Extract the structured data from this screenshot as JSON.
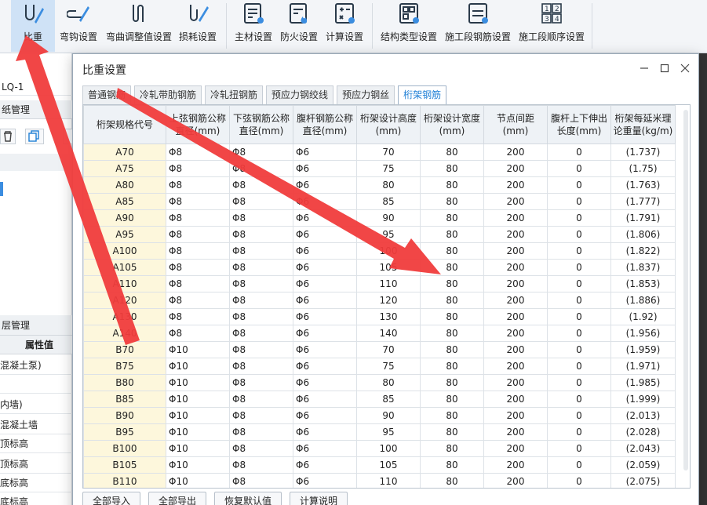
{
  "ribbon": {
    "buttons": [
      {
        "label": "比重",
        "icon": "ratio-icon"
      },
      {
        "label": "弯钩设置",
        "icon": "hook-icon"
      },
      {
        "label": "弯曲调整值设置",
        "icon": "bend-icon"
      },
      {
        "label": "损耗设置",
        "icon": "loss-icon"
      },
      {
        "label": "主材设置",
        "icon": "main-material-icon"
      },
      {
        "label": "防火设置",
        "icon": "fire-icon"
      },
      {
        "label": "计算设置",
        "icon": "calculator-icon"
      },
      {
        "label": "结构类型设置",
        "icon": "structure-icon"
      },
      {
        "label": "施工段钢筋设置",
        "icon": "segment-rebar-icon"
      },
      {
        "label": "施工段顺序设置",
        "icon": "sequence-icon"
      }
    ]
  },
  "left_panel": {
    "combo_value": "LQ-1",
    "drawing_mgmt": "纸管理",
    "floor_mgmt": "层管理",
    "prop_header": "属性值",
    "rows": [
      "混凝土泵)",
      "",
      "内墙)",
      "混凝土墙",
      "顶标高",
      "顶标高",
      "底标高",
      "底标高"
    ]
  },
  "dialog": {
    "title": "比重设置",
    "tabs": [
      "普通钢筋",
      "冷轧带肋钢筋",
      "冷轧扭钢筋",
      "预应力钢绞线",
      "预应力钢丝",
      "桁架钢筋"
    ],
    "active_tab": 5,
    "columns": [
      "桁架规格代号",
      "上弦钢筋公称直径(mm)",
      "下弦钢筋公称直径(mm)",
      "腹杆钢筋公称直径(mm)",
      "桁架设计高度(mm)",
      "桁架设计宽度(mm)",
      "节点间距(mm)",
      "腹杆上下伸出长度(mm)",
      "桁架每延米理论重量(kg/m)"
    ],
    "rows": [
      [
        "A70",
        "Φ8",
        "Φ8",
        "Φ6",
        "70",
        "80",
        "200",
        "0",
        "(1.737)"
      ],
      [
        "A75",
        "Φ8",
        "Φ8",
        "Φ6",
        "75",
        "80",
        "200",
        "0",
        "(1.75)"
      ],
      [
        "A80",
        "Φ8",
        "Φ8",
        "Φ6",
        "80",
        "80",
        "200",
        "0",
        "(1.763)"
      ],
      [
        "A85",
        "Φ8",
        "Φ8",
        "Φ6",
        "85",
        "80",
        "200",
        "0",
        "(1.777)"
      ],
      [
        "A90",
        "Φ8",
        "Φ8",
        "Φ6",
        "90",
        "80",
        "200",
        "0",
        "(1.791)"
      ],
      [
        "A95",
        "Φ8",
        "Φ8",
        "Φ6",
        "95",
        "80",
        "200",
        "0",
        "(1.806)"
      ],
      [
        "A100",
        "Φ8",
        "Φ8",
        "Φ6",
        "100",
        "80",
        "200",
        "0",
        "(1.822)"
      ],
      [
        "A105",
        "Φ8",
        "Φ8",
        "Φ6",
        "105",
        "80",
        "200",
        "0",
        "(1.837)"
      ],
      [
        "A110",
        "Φ8",
        "Φ8",
        "Φ6",
        "110",
        "80",
        "200",
        "0",
        "(1.853)"
      ],
      [
        "A120",
        "Φ8",
        "Φ8",
        "Φ6",
        "120",
        "80",
        "200",
        "0",
        "(1.886)"
      ],
      [
        "A130",
        "Φ8",
        "Φ8",
        "Φ6",
        "130",
        "80",
        "200",
        "0",
        "(1.92)"
      ],
      [
        "A140",
        "Φ8",
        "Φ8",
        "Φ6",
        "140",
        "80",
        "200",
        "0",
        "(1.956)"
      ],
      [
        "B70",
        "Φ10",
        "Φ8",
        "Φ6",
        "70",
        "80",
        "200",
        "0",
        "(1.959)"
      ],
      [
        "B75",
        "Φ10",
        "Φ8",
        "Φ6",
        "75",
        "80",
        "200",
        "0",
        "(1.971)"
      ],
      [
        "B80",
        "Φ10",
        "Φ8",
        "Φ6",
        "80",
        "80",
        "200",
        "0",
        "(1.985)"
      ],
      [
        "B85",
        "Φ10",
        "Φ8",
        "Φ6",
        "85",
        "80",
        "200",
        "0",
        "(1.999)"
      ],
      [
        "B90",
        "Φ10",
        "Φ8",
        "Φ6",
        "90",
        "80",
        "200",
        "0",
        "(2.013)"
      ],
      [
        "B95",
        "Φ10",
        "Φ8",
        "Φ6",
        "95",
        "80",
        "200",
        "0",
        "(2.028)"
      ],
      [
        "B100",
        "Φ10",
        "Φ8",
        "Φ6",
        "100",
        "80",
        "200",
        "0",
        "(2.043)"
      ],
      [
        "B105",
        "Φ10",
        "Φ8",
        "Φ6",
        "105",
        "80",
        "200",
        "0",
        "(2.059)"
      ],
      [
        "B110",
        "Φ10",
        "Φ8",
        "Φ6",
        "110",
        "80",
        "200",
        "0",
        "(2.075)"
      ]
    ],
    "buttons": [
      "全部导入",
      "全部导出",
      "恢复默认值",
      "计算说明"
    ]
  },
  "colors": {
    "accent": "#1e7fd6",
    "arrow": "#f03c3c",
    "code_cell": "#fdf7dc"
  }
}
